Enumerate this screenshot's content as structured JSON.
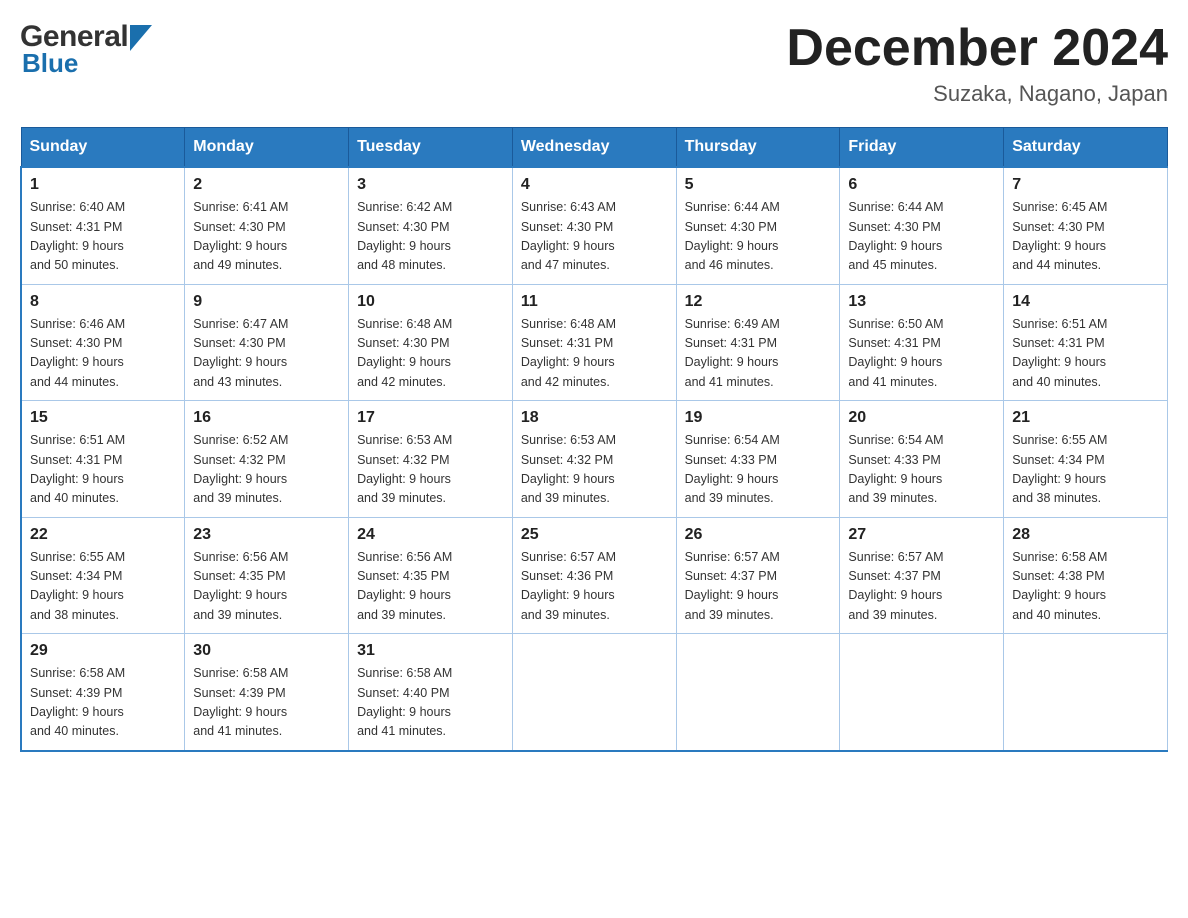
{
  "header": {
    "logo_general": "General",
    "logo_blue": "Blue",
    "month_title": "December 2024",
    "location": "Suzaka, Nagano, Japan"
  },
  "days_of_week": [
    "Sunday",
    "Monday",
    "Tuesday",
    "Wednesday",
    "Thursday",
    "Friday",
    "Saturday"
  ],
  "weeks": [
    [
      {
        "day": "1",
        "sunrise": "6:40 AM",
        "sunset": "4:31 PM",
        "daylight": "9 hours and 50 minutes."
      },
      {
        "day": "2",
        "sunrise": "6:41 AM",
        "sunset": "4:30 PM",
        "daylight": "9 hours and 49 minutes."
      },
      {
        "day": "3",
        "sunrise": "6:42 AM",
        "sunset": "4:30 PM",
        "daylight": "9 hours and 48 minutes."
      },
      {
        "day": "4",
        "sunrise": "6:43 AM",
        "sunset": "4:30 PM",
        "daylight": "9 hours and 47 minutes."
      },
      {
        "day": "5",
        "sunrise": "6:44 AM",
        "sunset": "4:30 PM",
        "daylight": "9 hours and 46 minutes."
      },
      {
        "day": "6",
        "sunrise": "6:44 AM",
        "sunset": "4:30 PM",
        "daylight": "9 hours and 45 minutes."
      },
      {
        "day": "7",
        "sunrise": "6:45 AM",
        "sunset": "4:30 PM",
        "daylight": "9 hours and 44 minutes."
      }
    ],
    [
      {
        "day": "8",
        "sunrise": "6:46 AM",
        "sunset": "4:30 PM",
        "daylight": "9 hours and 44 minutes."
      },
      {
        "day": "9",
        "sunrise": "6:47 AM",
        "sunset": "4:30 PM",
        "daylight": "9 hours and 43 minutes."
      },
      {
        "day": "10",
        "sunrise": "6:48 AM",
        "sunset": "4:30 PM",
        "daylight": "9 hours and 42 minutes."
      },
      {
        "day": "11",
        "sunrise": "6:48 AM",
        "sunset": "4:31 PM",
        "daylight": "9 hours and 42 minutes."
      },
      {
        "day": "12",
        "sunrise": "6:49 AM",
        "sunset": "4:31 PM",
        "daylight": "9 hours and 41 minutes."
      },
      {
        "day": "13",
        "sunrise": "6:50 AM",
        "sunset": "4:31 PM",
        "daylight": "9 hours and 41 minutes."
      },
      {
        "day": "14",
        "sunrise": "6:51 AM",
        "sunset": "4:31 PM",
        "daylight": "9 hours and 40 minutes."
      }
    ],
    [
      {
        "day": "15",
        "sunrise": "6:51 AM",
        "sunset": "4:31 PM",
        "daylight": "9 hours and 40 minutes."
      },
      {
        "day": "16",
        "sunrise": "6:52 AM",
        "sunset": "4:32 PM",
        "daylight": "9 hours and 39 minutes."
      },
      {
        "day": "17",
        "sunrise": "6:53 AM",
        "sunset": "4:32 PM",
        "daylight": "9 hours and 39 minutes."
      },
      {
        "day": "18",
        "sunrise": "6:53 AM",
        "sunset": "4:32 PM",
        "daylight": "9 hours and 39 minutes."
      },
      {
        "day": "19",
        "sunrise": "6:54 AM",
        "sunset": "4:33 PM",
        "daylight": "9 hours and 39 minutes."
      },
      {
        "day": "20",
        "sunrise": "6:54 AM",
        "sunset": "4:33 PM",
        "daylight": "9 hours and 39 minutes."
      },
      {
        "day": "21",
        "sunrise": "6:55 AM",
        "sunset": "4:34 PM",
        "daylight": "9 hours and 38 minutes."
      }
    ],
    [
      {
        "day": "22",
        "sunrise": "6:55 AM",
        "sunset": "4:34 PM",
        "daylight": "9 hours and 38 minutes."
      },
      {
        "day": "23",
        "sunrise": "6:56 AM",
        "sunset": "4:35 PM",
        "daylight": "9 hours and 39 minutes."
      },
      {
        "day": "24",
        "sunrise": "6:56 AM",
        "sunset": "4:35 PM",
        "daylight": "9 hours and 39 minutes."
      },
      {
        "day": "25",
        "sunrise": "6:57 AM",
        "sunset": "4:36 PM",
        "daylight": "9 hours and 39 minutes."
      },
      {
        "day": "26",
        "sunrise": "6:57 AM",
        "sunset": "4:37 PM",
        "daylight": "9 hours and 39 minutes."
      },
      {
        "day": "27",
        "sunrise": "6:57 AM",
        "sunset": "4:37 PM",
        "daylight": "9 hours and 39 minutes."
      },
      {
        "day": "28",
        "sunrise": "6:58 AM",
        "sunset": "4:38 PM",
        "daylight": "9 hours and 40 minutes."
      }
    ],
    [
      {
        "day": "29",
        "sunrise": "6:58 AM",
        "sunset": "4:39 PM",
        "daylight": "9 hours and 40 minutes."
      },
      {
        "day": "30",
        "sunrise": "6:58 AM",
        "sunset": "4:39 PM",
        "daylight": "9 hours and 41 minutes."
      },
      {
        "day": "31",
        "sunrise": "6:58 AM",
        "sunset": "4:40 PM",
        "daylight": "9 hours and 41 minutes."
      },
      null,
      null,
      null,
      null
    ]
  ],
  "labels": {
    "sunrise": "Sunrise:",
    "sunset": "Sunset:",
    "daylight": "Daylight:"
  }
}
